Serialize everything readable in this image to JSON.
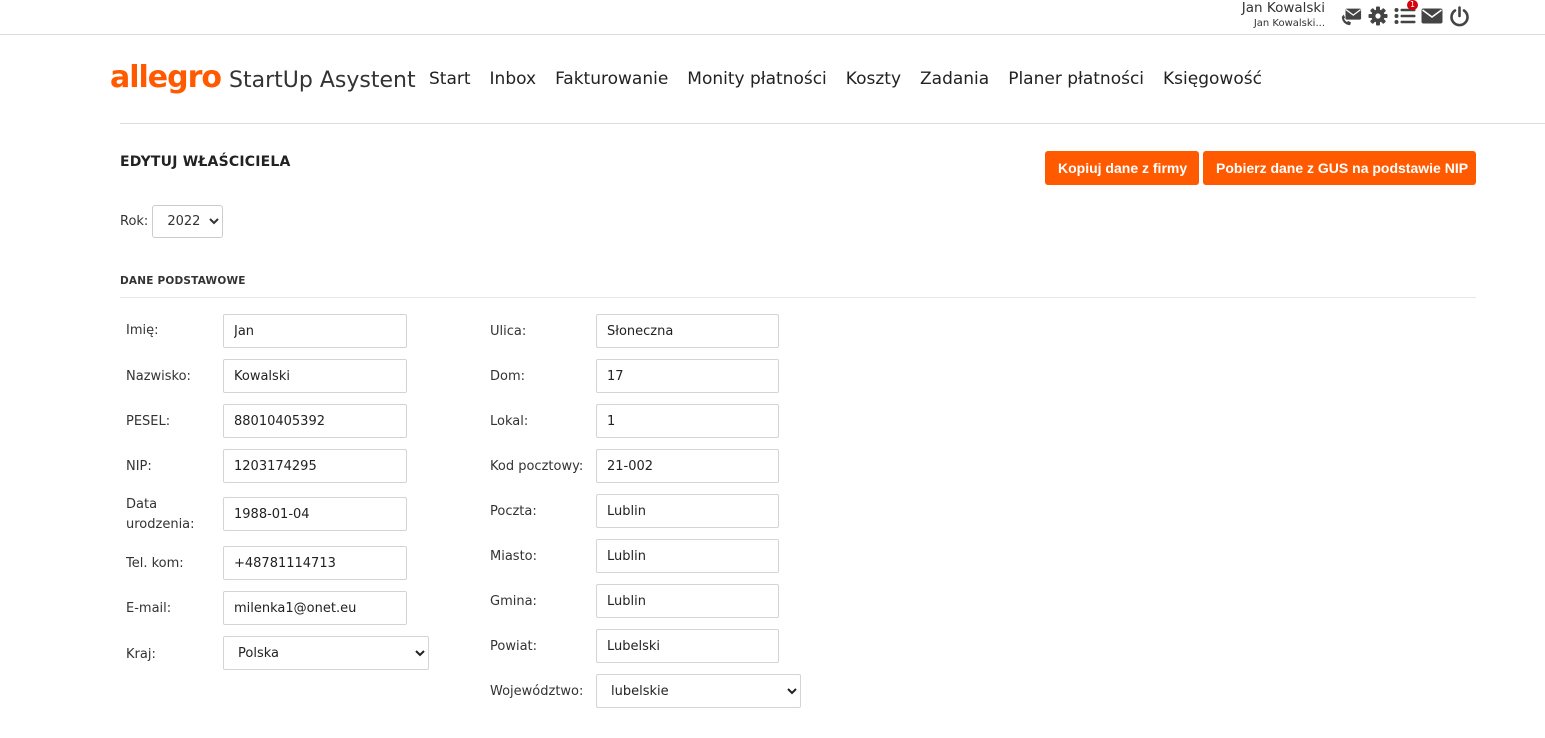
{
  "user": {
    "name": "Jan Kowalski",
    "sub": "Jan Kowalski..."
  },
  "top_icons": {
    "badge_count": "1"
  },
  "brand": {
    "logo": "allegro",
    "name": "StartUp Asystent",
    "color": "#ff5a00"
  },
  "nav": {
    "items": [
      "Start",
      "Inbox",
      "Fakturowanie",
      "Monity płatności",
      "Koszty",
      "Zadania",
      "Planer płatności",
      "Księgowość"
    ]
  },
  "page": {
    "title": "EDYTUJ WŁAŚCICIELA",
    "copy_button": "Kopiuj dane z firmy",
    "gus_button": "Pobierz dane z GUS na podstawie NIP",
    "year_label": "Rok:",
    "year_value": "2022",
    "section_title": "DANE PODSTAWOWE"
  },
  "form": {
    "left": {
      "imie": {
        "label": "Imię:",
        "value": "Jan"
      },
      "nazwisko": {
        "label": "Nazwisko:",
        "value": "Kowalski"
      },
      "pesel": {
        "label": "PESEL:",
        "value": "88010405392"
      },
      "nip": {
        "label": "NIP:",
        "value": "1203174295"
      },
      "data_urodzenia": {
        "label": "Data urodzenia:",
        "value": "1988-01-04"
      },
      "tel": {
        "label": "Tel. kom:",
        "value": "+48781114713"
      },
      "email": {
        "label": "E-mail:",
        "value": "milenka1@onet.eu"
      },
      "kraj": {
        "label": "Kraj:",
        "value": "Polska"
      }
    },
    "right": {
      "ulica": {
        "label": "Ulica:",
        "value": "Słoneczna"
      },
      "dom": {
        "label": "Dom:",
        "value": "17"
      },
      "lokal": {
        "label": "Lokal:",
        "value": "1"
      },
      "kod": {
        "label": "Kod pocztowy:",
        "value": "21-002"
      },
      "poczta": {
        "label": "Poczta:",
        "value": "Lublin"
      },
      "miasto": {
        "label": "Miasto:",
        "value": "Lublin"
      },
      "gmina": {
        "label": "Gmina:",
        "value": "Lublin"
      },
      "powiat": {
        "label": "Powiat:",
        "value": "Lubelski"
      },
      "wojewodztwo": {
        "label": "Województwo:",
        "value": "lubelskie"
      }
    }
  }
}
